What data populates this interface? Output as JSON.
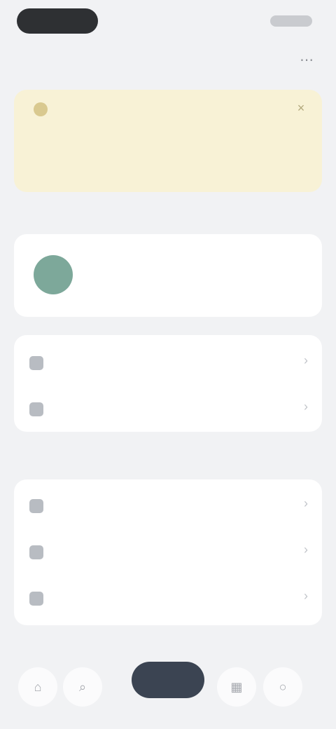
{
  "header": {
    "title": "",
    "action_icon": "more-icon"
  },
  "banner": {
    "text": "",
    "link_label": "",
    "close_glyph": "×"
  },
  "profile": {
    "name": "",
    "subtitle": ""
  },
  "list1": {
    "items": [
      {
        "label": "",
        "icon": "settings-icon"
      },
      {
        "label": "",
        "icon": "account-icon"
      }
    ]
  },
  "section_title": "",
  "list2": {
    "items": [
      {
        "label": "",
        "icon": "help-icon"
      },
      {
        "label": "",
        "icon": "info-icon"
      },
      {
        "label": "",
        "icon": "document-icon"
      }
    ]
  },
  "section_title_2": "",
  "bottom_nav": {
    "primary_label": "",
    "left_icons": [
      "home-icon",
      "search-icon"
    ],
    "right_icons": [
      "grid-icon",
      "profile-icon"
    ]
  },
  "colors": {
    "banner_bg": "#f8f2d6",
    "accent": "#b39b2f",
    "avatar": "#7da89a",
    "primary_button": "#3b4452"
  }
}
